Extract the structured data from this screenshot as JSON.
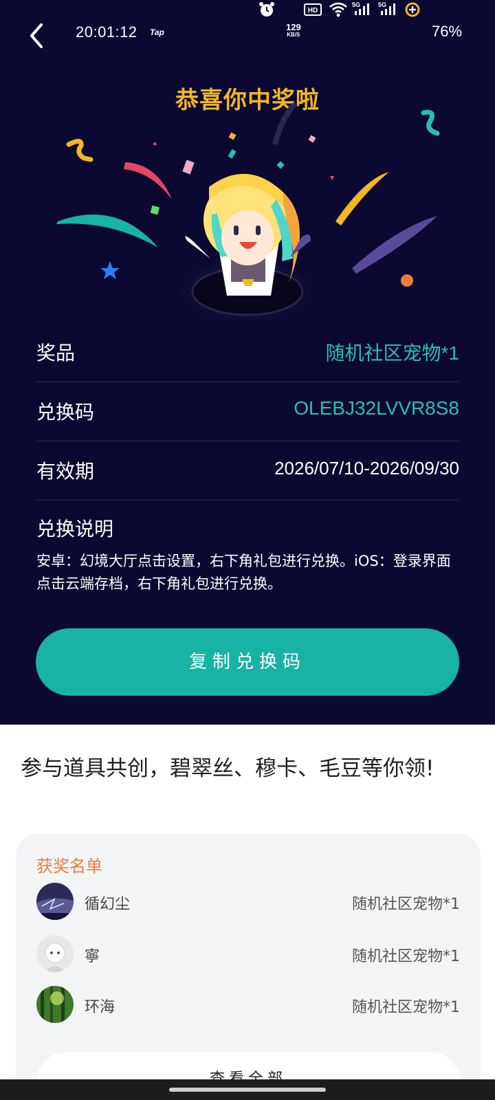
{
  "status_bar": {
    "time": "20:01:12",
    "tap_label": "Tap",
    "net_speed_value": "129",
    "net_speed_unit": "KB/S",
    "battery": "76%"
  },
  "header": {
    "title": "恭喜你中奖啦"
  },
  "reward": {
    "prize_label": "奖品",
    "prize_value": "随机社区宠物*1",
    "code_label": "兑换码",
    "code_value": "OLEBJ32LVVR8S8",
    "validity_label": "有效期",
    "validity_value": "2026/07/10-2026/09/30",
    "instructions_title": "兑换说明",
    "instructions_text": "安卓：幻境大厅点击设置，右下角礼包进行兑换。iOS：登录界面点击云端存档，右下角礼包进行兑换。"
  },
  "copy_button_label": "复制兑换码",
  "promo_text": "参与道具共创，碧翠丝、穆卡、毛豆等你领!",
  "winners": {
    "title": "获奖名单",
    "items": [
      {
        "name": "循幻尘",
        "prize": "随机社区宠物*1"
      },
      {
        "name": "寧",
        "prize": "随机社区宠物*1"
      },
      {
        "name": "环海",
        "prize": "随机社区宠物*1"
      }
    ],
    "view_all_label": "查看全部"
  },
  "colors": {
    "background_dark": "#0b0931",
    "accent_teal": "#17b3a5",
    "title_gold": "#f3b624",
    "winners_title": "#ef7b3b"
  }
}
